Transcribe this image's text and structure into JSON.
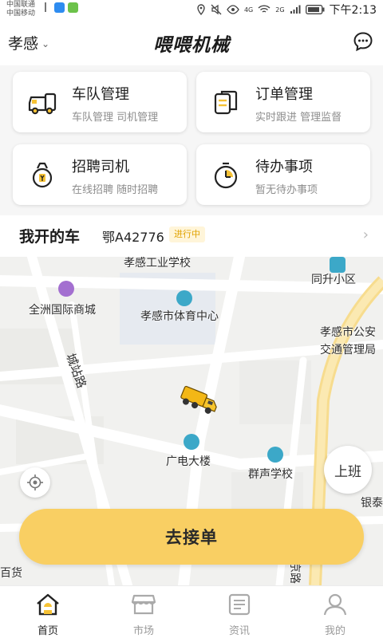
{
  "status_bar": {
    "carrier_1": "中国联通",
    "carrier_2": "中国移动",
    "network_4g": "4G",
    "network_2g": "2G",
    "time": "下午2:13"
  },
  "header": {
    "city": "孝感",
    "brand": "喂喂机械",
    "message_icon": "chat-bubble-icon"
  },
  "cards": [
    {
      "title": "车队管理",
      "subtitle": "车队管理 司机管理",
      "icon": "truck-icon"
    },
    {
      "title": "订单管理",
      "subtitle": "实时跟进 管理监督",
      "icon": "documents-icon"
    },
    {
      "title": "招聘司机",
      "subtitle": "在线招聘 随时招聘",
      "icon": "recruit-bag-icon"
    },
    {
      "title": "待办事项",
      "subtitle": "暂无待办事项",
      "icon": "clock-icon"
    }
  ],
  "my_car": {
    "title": "我开的车",
    "plate": "鄂A42776",
    "status": "进行中"
  },
  "map": {
    "labels": {
      "school": "孝感工业学校",
      "community": "同升小区",
      "mall": "全洲国际商城",
      "stadium": "孝感市体育中心",
      "police_1": "孝感市公安",
      "police_2": "交通管理局",
      "road": "城站路",
      "tv_building": "广电大楼",
      "qunsheng_school": "群声学校",
      "yintai": "银泰",
      "baihuo": "百货",
      "jinglu": "京路"
    },
    "on_duty_label": "上班",
    "accept_order_label": "去接单"
  },
  "tabbar": {
    "items": [
      {
        "label": "首页",
        "icon": "home-icon",
        "active": true
      },
      {
        "label": "市场",
        "icon": "market-icon",
        "active": false
      },
      {
        "label": "资讯",
        "icon": "news-icon",
        "active": false
      },
      {
        "label": "我的",
        "icon": "profile-icon",
        "active": false
      }
    ]
  },
  "colors": {
    "accent": "#f9cf63",
    "badge_text": "#e0a200",
    "poi_purple": "#a36fd0",
    "poi_teal": "#3ca8c8"
  }
}
